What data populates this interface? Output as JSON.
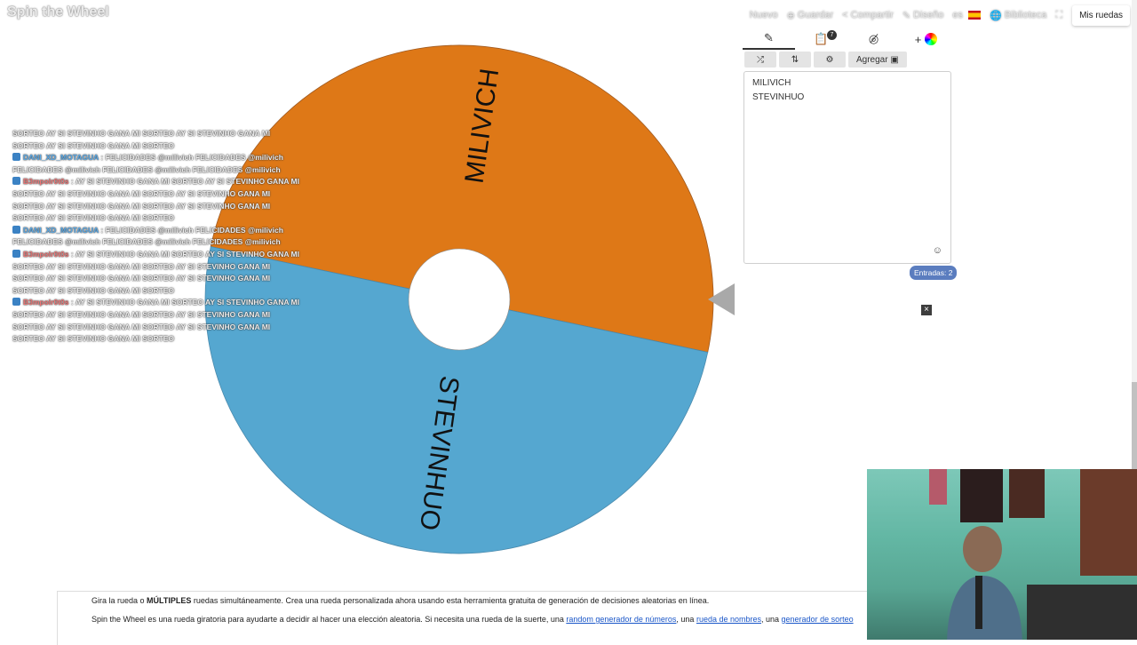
{
  "app": {
    "logo": "Spin the Wheel"
  },
  "nav": {
    "nuevo": "Nuevo",
    "guardar": "Guardar",
    "compartir": "Compartir",
    "diseno": "Diseño",
    "lang": "es",
    "biblioteca": "Biblioteca",
    "mis_ruedas": "Mis ruedas"
  },
  "wheel": {
    "segments": [
      {
        "label": "MILIVICH",
        "color": "#de7817"
      },
      {
        "label": "STEVINHUO",
        "color": "#55a7d0"
      }
    ]
  },
  "chat": [
    {
      "user": "",
      "text": "SORTEO  AY SI STEVINHO GANA MI SORTEO  AY SI STEVINHO GANA MI"
    },
    {
      "user": "",
      "text": "SORTEO  AY SI STEVINHO GANA MI SORTEO "
    },
    {
      "user": "DANI_XD_MOTAGUA",
      "text": ": FELICIDADES @milivich FELICIDADES @milivich"
    },
    {
      "user": "",
      "text": "FELICIDADES @milivich FELICIDADES @milivich FELICIDADES @milivich"
    },
    {
      "user": "B3mpolr0t0s",
      "text": ": AY SI STEVINHO GANA MI SORTEO  AY SI STEVINHO GANA MI"
    },
    {
      "user": "",
      "text": "SORTEO  AY SI STEVINHO GANA MI SORTEO  AY SI STEVINHO GANA MI"
    },
    {
      "user": "",
      "text": "SORTEO  AY SI STEVINHO GANA MI SORTEO  AY SI STEVINHO GANA MI"
    },
    {
      "user": "",
      "text": "SORTEO  AY SI STEVINHO GANA MI SORTEO "
    },
    {
      "user": "DANI_XD_MOTAGUA",
      "text": ": FELICIDADES @milivich FELICIDADES @milivich"
    },
    {
      "user": "",
      "text": "FELICIDADES @milivich FELICIDADES @milivich FELICIDADES @milivich"
    },
    {
      "user": "B3mpolr0t0s",
      "text": ": AY SI STEVINHO GANA MI SORTEO  AY SI STEVINHO GANA MI"
    },
    {
      "user": "",
      "text": "SORTEO  AY SI STEVINHO GANA MI SORTEO  AY SI STEVINHO GANA MI"
    },
    {
      "user": "",
      "text": "SORTEO  AY SI STEVINHO GANA MI SORTEO  AY SI STEVINHO GANA MI"
    },
    {
      "user": "",
      "text": "SORTEO  AY SI STEVINHO GANA MI SORTEO "
    },
    {
      "user": "B3mpolr0t0s",
      "text": ": AY SI STEVINHO GANA MI SORTEO  AY SI STEVINHO GANA MI"
    },
    {
      "user": "",
      "text": "SORTEO  AY SI STEVINHO GANA MI SORTEO  AY SI STEVINHO GANA MI"
    },
    {
      "user": "",
      "text": "SORTEO  AY SI STEVINHO GANA MI SORTEO  AY SI STEVINHO GANA MI"
    },
    {
      "user": "",
      "text": "SORTEO  AY SI STEVINHO GANA MI SORTEO "
    }
  ],
  "panel": {
    "tab_badge": "7",
    "add_plus": "+",
    "agregar_label": "Agregar",
    "entries": [
      "MILIVICH",
      "STEVINHUO"
    ],
    "entries_count_label": "Entradas: 2",
    "close_symbol": "×"
  },
  "content": {
    "line1_pre": "Gira la rueda o ",
    "line1_bold": "MÚLTIPLES",
    "line1_post": " ruedas simultáneamente. Crea una rueda personalizada ahora usando esta herramienta gratuita de generación de decisiones aleatorias en línea.",
    "line2_pre": "Spin the Wheel es una rueda giratoria para ayudarte a decidir al hacer una elección aleatoria. Si necesita una rueda de la suerte, una ",
    "link1": "random generador de números",
    "line2_mid1": ", una ",
    "link2": "rueda de nombres",
    "line2_mid2": ", una ",
    "link3": "generador de sorteo"
  }
}
